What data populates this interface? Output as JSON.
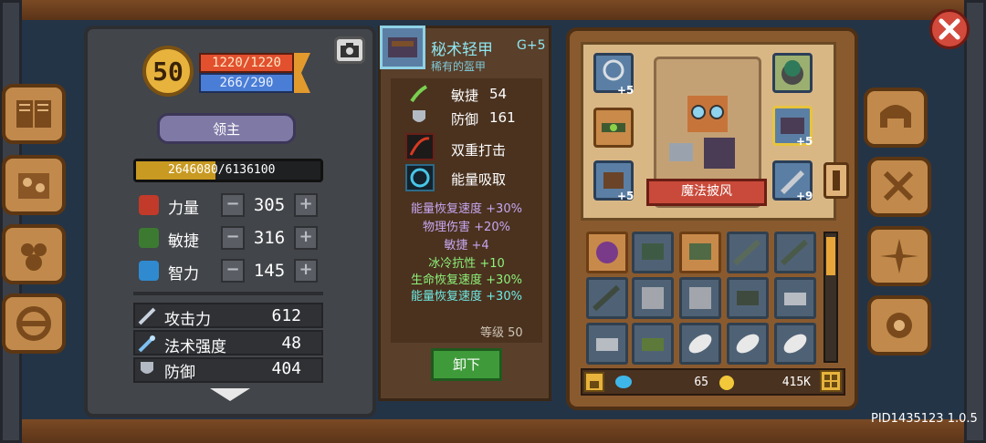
{
  "player": {
    "level": "50",
    "hp": "1220/1220",
    "mp": "266/290",
    "rank": "领主",
    "exp": "2646080/6136100",
    "exp_fraction": 0.43
  },
  "attributes": [
    {
      "label": "力量",
      "value": "305"
    },
    {
      "label": "敏捷",
      "value": "316"
    },
    {
      "label": "智力",
      "value": "145"
    }
  ],
  "stats": [
    {
      "label": "攻击力",
      "value": "612"
    },
    {
      "label": "法术强度",
      "value": "48"
    },
    {
      "label": "防御",
      "value": "404"
    }
  ],
  "item": {
    "name": "秘术轻甲",
    "grade": "G+5",
    "rarity": "稀有的盔甲",
    "props": [
      {
        "label": "敏捷",
        "value": "54"
      },
      {
        "label": "防御",
        "value": "161"
      }
    ],
    "skills": [
      "双重打击",
      "能量吸取"
    ],
    "bonuses": [
      {
        "text": "能量恢复速度 +30%",
        "color": "purple"
      },
      {
        "text": "物理伤害 +20%",
        "color": "purple"
      },
      {
        "text": "敏捷 +4",
        "color": "purple"
      },
      {
        "text": "冰冷抗性 +10",
        "color": "green"
      },
      {
        "text": "生命恢复速度 +30%",
        "color": "green"
      },
      {
        "text": "能量恢复速度 +30%",
        "color": "cyan"
      }
    ],
    "level_label": "等级 50",
    "unequip_label": "卸下"
  },
  "equipment": {
    "cape_label": "魔法披风",
    "plus_left_top": "+5",
    "plus_left_bottom": "+5",
    "plus_right_mid": "+5",
    "plus_right_bottom": "+9"
  },
  "currency": {
    "gems": "65",
    "gold": "415K"
  },
  "version": "PID1435123 1.0.5",
  "colors": {
    "gold": "#e7b33d",
    "hp": "#e2502e",
    "mp": "#4a7dd6",
    "unequip": "#3f9b3a",
    "item_title": "#8ee6f0"
  },
  "icons": [
    "book-icon",
    "recipe-icon",
    "pets-icon",
    "steering-wheel-icon",
    "helmet-icon",
    "swords-icon",
    "compass-icon",
    "gear-icon",
    "camera-icon",
    "close-icon"
  ]
}
